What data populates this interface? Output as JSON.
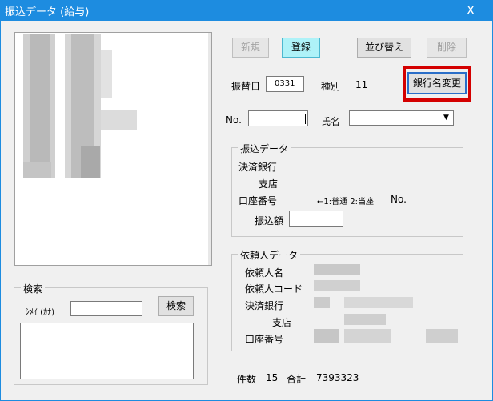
{
  "window": {
    "title": "振込データ (給与)",
    "close_glyph": "X"
  },
  "toolbar": {
    "new_label": "新規",
    "register_label": "登録",
    "sort_label": "並び替え",
    "delete_label": "削除",
    "bank_change_label": "銀行名変更"
  },
  "transfer_date": {
    "label": "振替日",
    "value": "0331"
  },
  "kind": {
    "label": "種別",
    "value": "11"
  },
  "no_field": {
    "label": "No.",
    "value": ""
  },
  "name_field": {
    "label": "氏名",
    "value": ""
  },
  "transfer_group": {
    "legend": "振込データ",
    "bank_label": "決済銀行",
    "branch_label": "支店",
    "account_label": "口座番号",
    "account_note": "←1:普通 2:当座",
    "no_label": "No.",
    "amount_label": "振込額",
    "amount_value": ""
  },
  "requester_group": {
    "legend": "依頼人データ",
    "name_label": "依頼人名",
    "code_label": "依頼人コード",
    "bank_label": "決済銀行",
    "branch_label": "支店",
    "account_label": "口座番号"
  },
  "search_group": {
    "legend": "検索",
    "kana_label": "ｼﾒｲ (ｶﾅ)",
    "kana_value": "",
    "button_label": "検索"
  },
  "summary": {
    "count_label": "件数",
    "count_value": "15",
    "total_label": "合計",
    "total_value": "7393323"
  }
}
